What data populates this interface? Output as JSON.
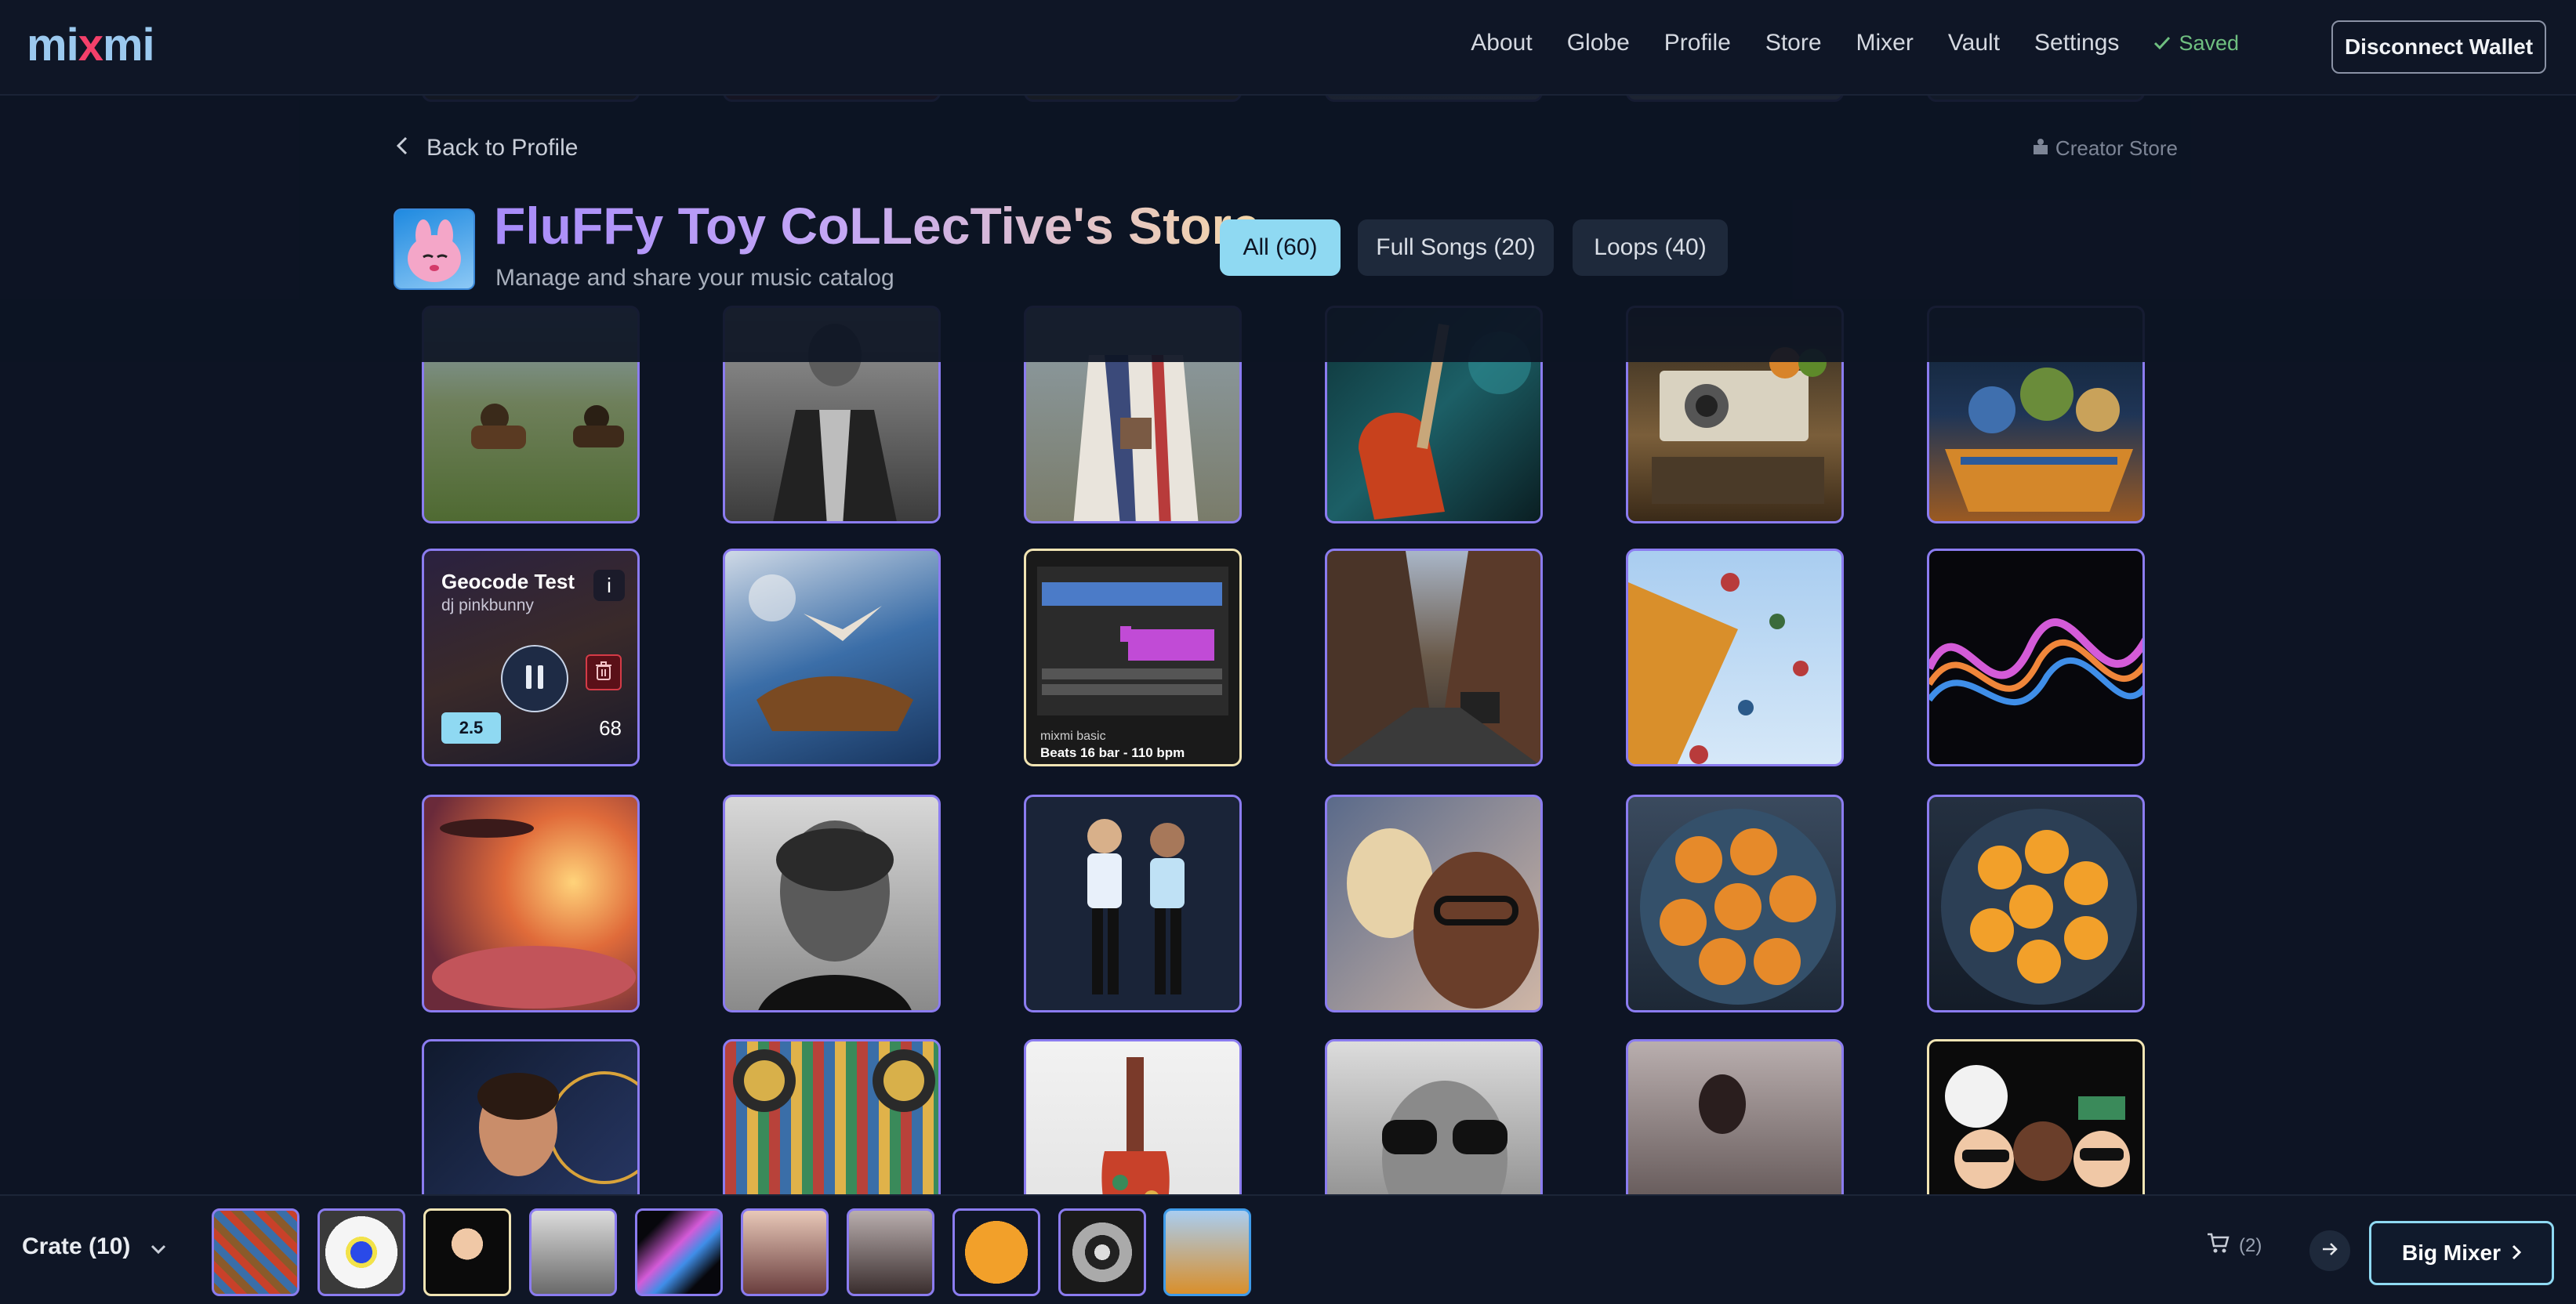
{
  "nav": {
    "logo_pre": "mi",
    "logo_x": "x",
    "logo_post": "mi",
    "links": [
      "About",
      "Globe",
      "Profile",
      "Store",
      "Mixer",
      "Vault",
      "Settings"
    ],
    "saved_label": "Saved",
    "disconnect_label": "Disconnect Wallet"
  },
  "header": {
    "back_label": "Back to Profile",
    "creator_store_label": "Creator Store",
    "title": "FluFFy Toy CoLLecTive's Store",
    "subtitle": "Manage and share your music catalog",
    "filters": [
      "All (60)",
      "Full Songs (20)",
      "Loops (40)"
    ],
    "active_filter": 0
  },
  "featured_tile": {
    "title": "Geocode Test",
    "artist": "dj pinkbunny",
    "info_label": "i",
    "price": "2.5",
    "count": "68"
  },
  "loop_tile": {
    "brand": "mixmi basic",
    "name": "Beats 16 bar - 110 bpm"
  },
  "crate": {
    "label": "Crate (10)",
    "cart_count": "(2)",
    "big_mixer_label": "Big Mixer"
  },
  "colors": {
    "background": "#0d1424",
    "tile_border": "#8b7cf0",
    "loop_border": "#f1e4b3",
    "accent": "#8fd9f2",
    "saved": "#6fbf80"
  },
  "icons": [
    "check-icon",
    "chevron-left-icon",
    "store-icon",
    "pause-icon",
    "trash-icon",
    "chevron-down-icon",
    "cart-icon",
    "arrow-right-icon",
    "chevron-right-icon"
  ]
}
